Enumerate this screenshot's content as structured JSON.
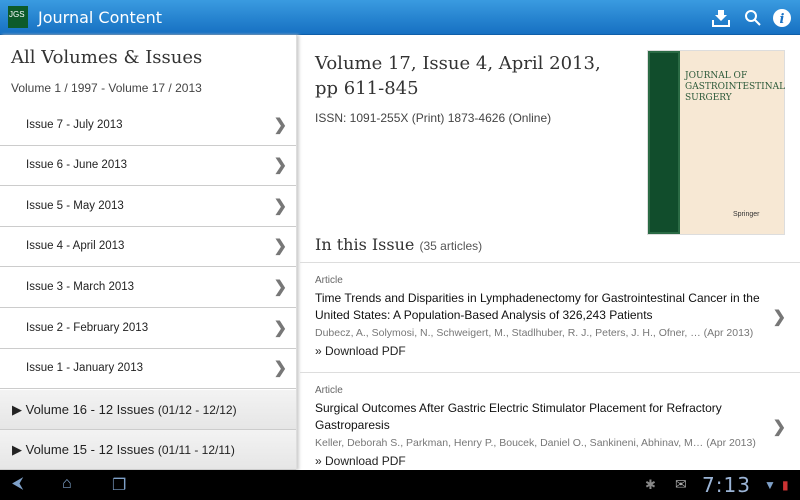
{
  "app": {
    "logo": "JGS",
    "title": "Journal Content"
  },
  "toolbar": {
    "icons": [
      "download-icon",
      "search-icon",
      "info-icon"
    ]
  },
  "sidebar": {
    "title": "All Volumes & Issues",
    "subtitle": "Volume 1 / 1997 - Volume 17 / 2013",
    "issues": [
      {
        "label": "Issue 7 - July 2013"
      },
      {
        "label": "Issue 6 - June 2013"
      },
      {
        "label": "Issue 5 - May 2013"
      },
      {
        "label": "Issue 4 - April 2013"
      },
      {
        "label": "Issue 3 - March 2013"
      },
      {
        "label": "Issue 2 - February 2013"
      },
      {
        "label": "Issue 1 - January 2013"
      }
    ],
    "volumes": [
      {
        "label": "Volume 16 - 12 Issues",
        "range": "(01/12  -  12/12)"
      },
      {
        "label": "Volume 15 - 12 Issues",
        "range": "(01/11  -  12/11)"
      }
    ]
  },
  "main": {
    "title": "Volume 17, Issue 4, April 2013, pp 611-845",
    "issn": "ISSN: 1091-255X (Print) 1873-4626 (Online)",
    "cover": {
      "text": "JOURNAL OF GASTROINTESTINAL SURGERY",
      "publisher": "Springer"
    },
    "in_issue": "In this Issue",
    "count": "(35 articles)",
    "articles": [
      {
        "type": "Article",
        "title": "Time Trends and Disparities in Lymphadenectomy for Gastrointestinal Cancer in the United States: A Population-Based Analysis of 326,243 Patients",
        "authors": "Dubecz, A., Solymosi, N., Schweigert, M., Stadlhuber, R. J., Peters, J. H., Ofner, …",
        "date": "(Apr 2013)",
        "download": "Download PDF"
      },
      {
        "type": "Article",
        "title": "Surgical Outcomes After Gastric Electric Stimulator Placement for Refractory Gastroparesis",
        "authors": "Keller, Deborah S., Parkman, Henry P., Boucek, Daniel O., Sankineni, Abhinav, M…",
        "date": "(Apr 2013)",
        "download": "Download PDF"
      }
    ]
  },
  "statusbar": {
    "time": "7:13"
  }
}
